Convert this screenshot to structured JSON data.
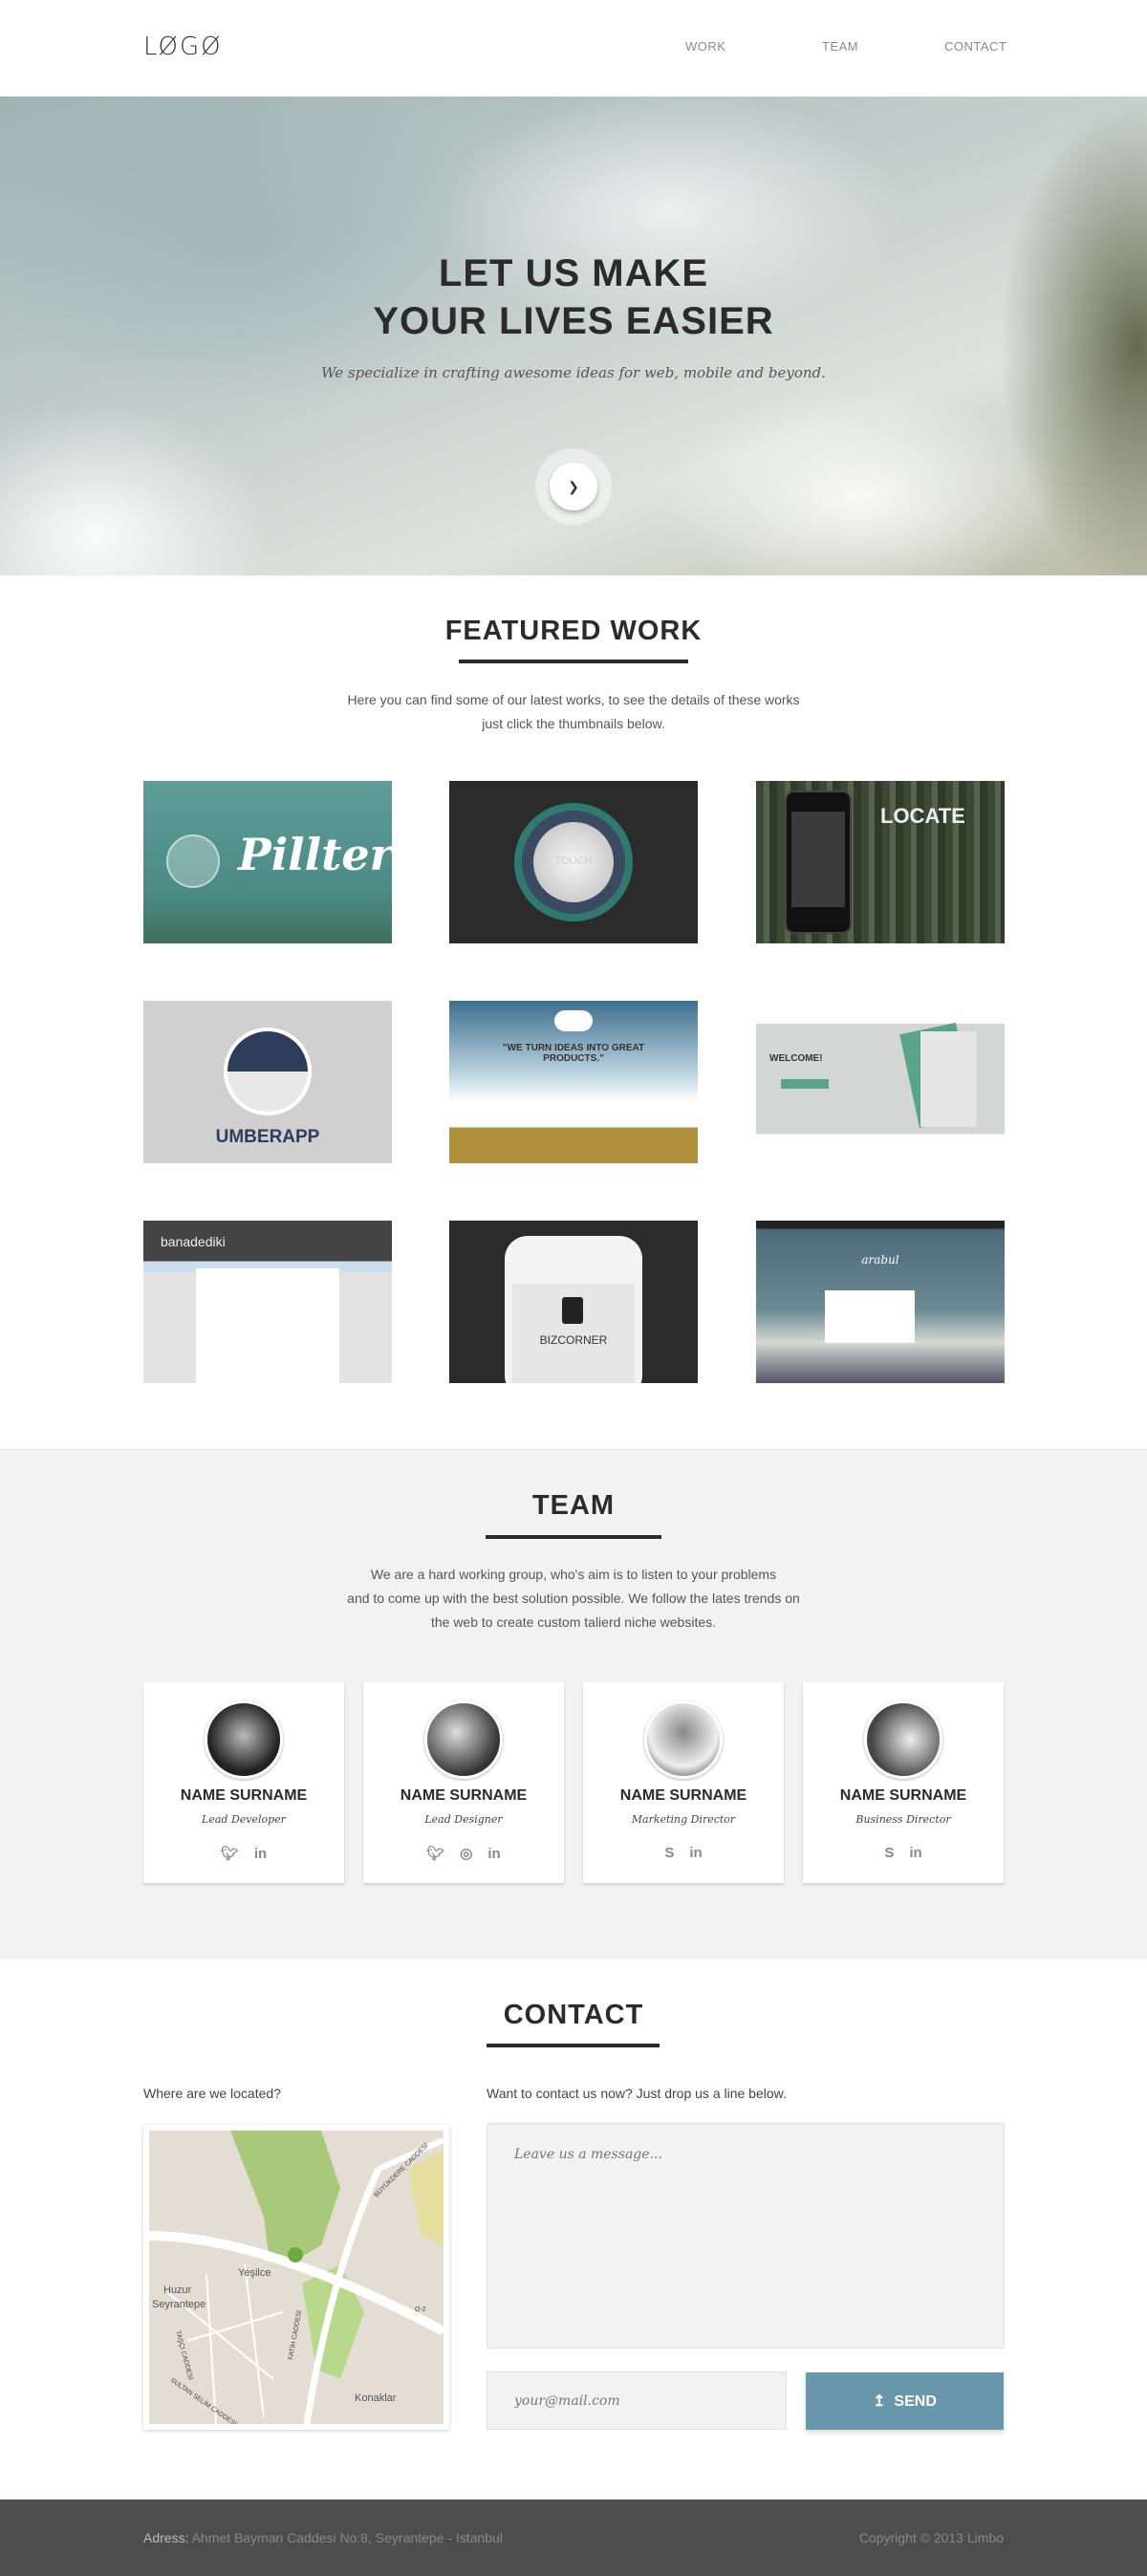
{
  "header": {
    "logo": "LØGØ",
    "nav": [
      "WORK",
      "TEAM",
      "CONTACT"
    ]
  },
  "hero": {
    "title_line1": "LET US MAKE",
    "title_line2": "YOUR LIVES EASIER",
    "subtitle": "We specialize in crafting awesome ideas for web, mobile and beyond.",
    "scroll_icon": "chevron-down-icon"
  },
  "work": {
    "title": "FEATURED WORK",
    "description_line1": "Here you can find some of our latest works, to see the details of these works",
    "description_line2": "just click the thumbnails below.",
    "thumbnails": [
      "Pillter",
      "TOUCH",
      "LOCATE",
      "UMBERAPP",
      "\"WE TURN IDEAS INTO GREAT PRODUCTS.\"",
      "WELCOME!",
      "banadediki",
      "BIZCORNER",
      "arabul"
    ]
  },
  "team": {
    "title": "TEAM",
    "description_line1": "We are a hard working group, who's aim is to listen to your problems",
    "description_line2": "and to come up with the best solution possible. We follow the lates trends on",
    "description_line3": "the web to create custom talierd niche websites.",
    "members": [
      {
        "name": "NAME SURNAME",
        "role": "Lead Developer",
        "icons": [
          "twitter-icon",
          "linkedin-icon"
        ]
      },
      {
        "name": "NAME SURNAME",
        "role": "Lead Designer",
        "icons": [
          "twitter-icon",
          "dribbble-icon",
          "linkedin-icon"
        ]
      },
      {
        "name": "NAME SURNAME",
        "role": "Marketing Director",
        "icons": [
          "skype-icon",
          "linkedin-icon"
        ]
      },
      {
        "name": "NAME SURNAME",
        "role": "Business Director",
        "icons": [
          "skype-icon",
          "linkedin-icon"
        ]
      }
    ]
  },
  "contact": {
    "title": "CONTACT",
    "map_label": "Where are we located?",
    "form_label": "Want to contact us now? Just drop us a line below.",
    "map_places": [
      "Huzur",
      "Yeşilce",
      "Seyrantepe",
      "Konaklar",
      "BÜYÜKDERE CADDESİ",
      "FATİH CADDESİ",
      "O-2",
      "TAŞÇI CADDESİ",
      "SULTAN SELİM CADDESİ"
    ],
    "message_placeholder": "Leave us a message...",
    "email_placeholder": "your@mail.com",
    "send_label": "SEND",
    "send_color": "#6896ab"
  },
  "footer": {
    "address_label": "Adress:",
    "address": "Ahmet Bayman Caddesi No:8, Seyrantepe - Istanbul",
    "copyright": "Copyright © 2013 Limbo"
  }
}
